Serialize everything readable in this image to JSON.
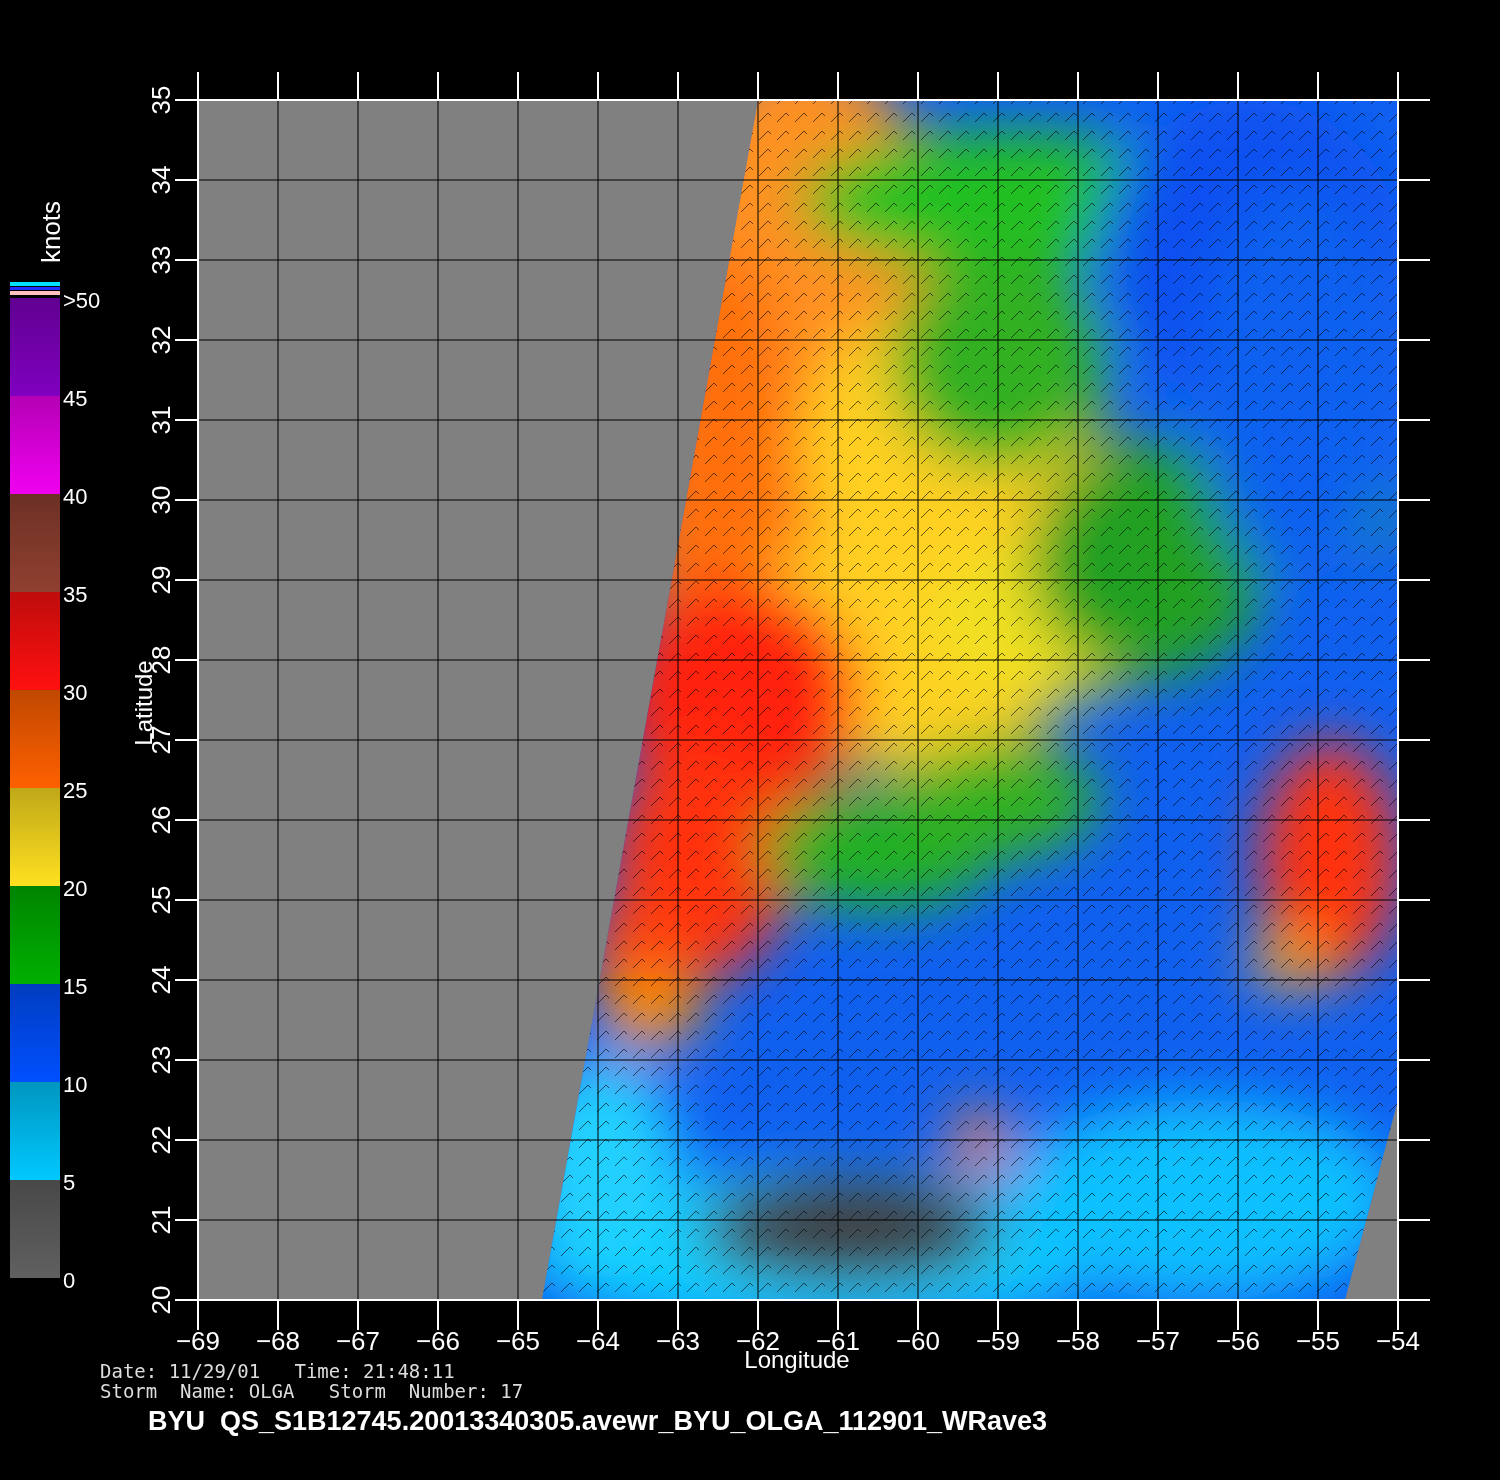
{
  "plot": {
    "xlabel": "Longitude",
    "ylabel": "Latitude",
    "x_ticks": [
      "−69",
      "−68",
      "−67",
      "−66",
      "−65",
      "−64",
      "−63",
      "−62",
      "−61",
      "−60",
      "−59",
      "−58",
      "−57",
      "−56",
      "−55",
      "−54"
    ],
    "y_ticks": [
      "20",
      "21",
      "22",
      "23",
      "24",
      "25",
      "26",
      "27",
      "28",
      "29",
      "30",
      "31",
      "32",
      "33",
      "34",
      "35"
    ]
  },
  "colorbar": {
    "unit": "knots",
    "labels": [
      ">50",
      "45",
      "40",
      "35",
      "30",
      "25",
      "20",
      "15",
      "10",
      "5",
      "0"
    ],
    "bands": [
      {
        "color": "#606060"
      },
      {
        "color": "#00c8ff"
      },
      {
        "color": "#0050ff"
      },
      {
        "color": "#00b000"
      },
      {
        "color": "#ffe020"
      },
      {
        "color": "#ff6000"
      },
      {
        "color": "#ff1010"
      },
      {
        "color": "#904030"
      },
      {
        "color": "#f000f0"
      },
      {
        "color": "#8000c0"
      }
    ]
  },
  "info": {
    "line_1": "Date: 11/29/01   Time: 21:48:11",
    "line_2": "Storm  Name: OLGA   Storm  Number: 17",
    "title": "BYU  QS_S1B12745.20013340305.avewr_BYU_OLGA_112901_WRave3"
  }
}
